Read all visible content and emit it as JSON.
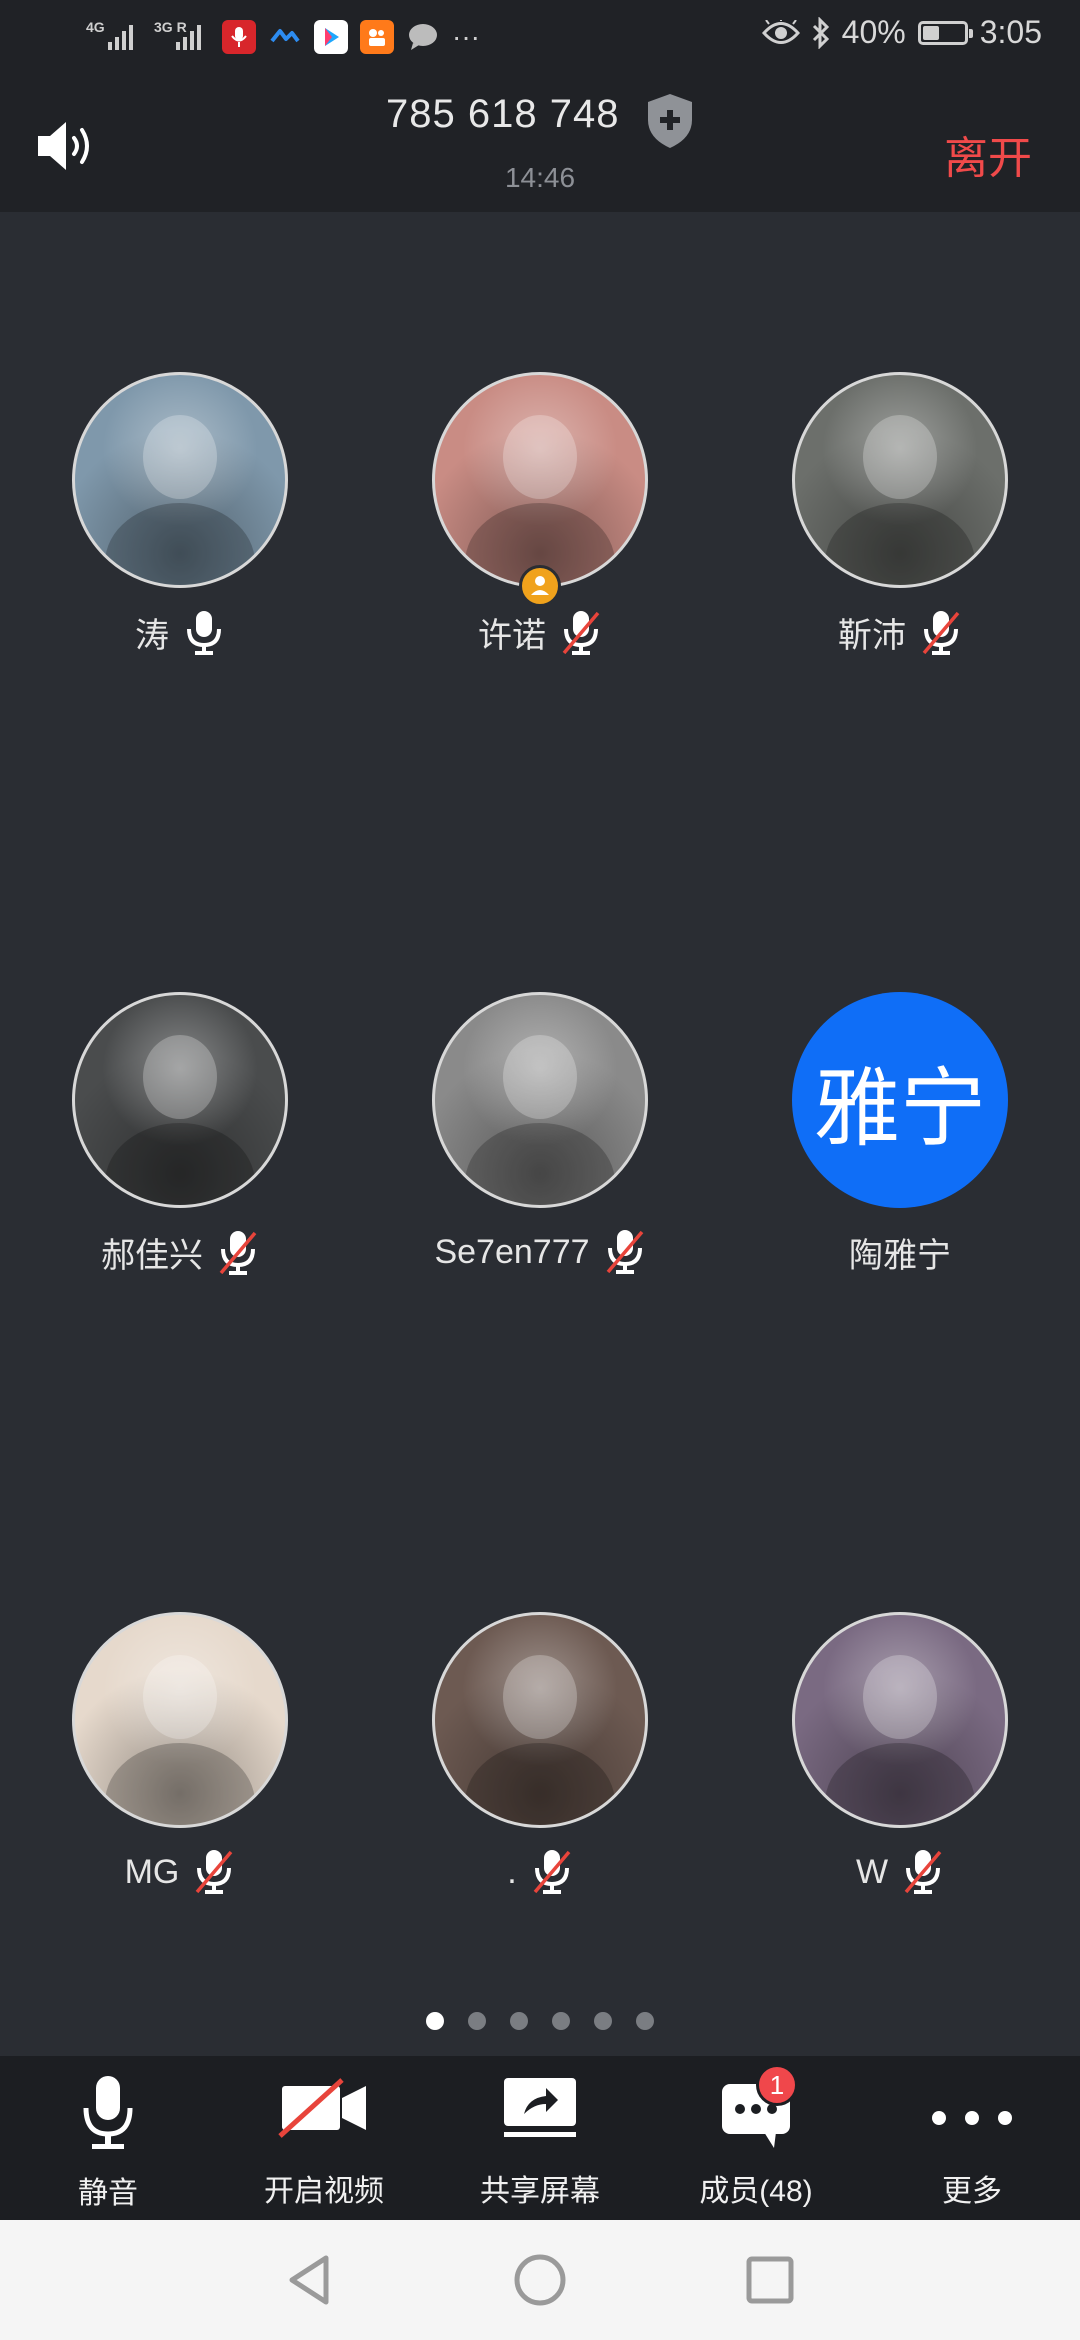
{
  "status_bar": {
    "signal_1_label": "4G",
    "signal_2_label": "3G R",
    "bluetooth_battery_text": "40%",
    "battery_level": 0.4,
    "time": "3:05",
    "more_notifications": "···",
    "notification_icons": [
      "recorder-app-icon",
      "dingtalk-app-icon",
      "youku-app-icon",
      "kuaishou-app-icon",
      "message-bubble-icon"
    ]
  },
  "header": {
    "meeting_id": "785 618 748",
    "duration": "14:46",
    "leave_label": "离开"
  },
  "participants": [
    {
      "name": "涛",
      "mic": "on",
      "avatar_color": "#7f98ab",
      "host": false
    },
    {
      "name": "许诺",
      "mic": "muted",
      "avatar_color": "#c98c84",
      "host": true
    },
    {
      "name": "靳沛",
      "mic": "muted",
      "avatar_color": "#6c6f6b",
      "host": false
    },
    {
      "name": "郝佳兴",
      "mic": "muted",
      "avatar_color": "#4a4c4d",
      "host": false
    },
    {
      "name": "Se7en777",
      "mic": "muted",
      "avatar_color": "#8a8a8a",
      "host": false
    },
    {
      "name": "陶雅宁",
      "mic": "none",
      "avatar_text": "雅宁",
      "avatar_color": "#0f6ef7",
      "host": false
    },
    {
      "name": "MG",
      "mic": "muted",
      "avatar_color": "#e6d9cc",
      "host": false
    },
    {
      "name": ".",
      "mic": "muted",
      "avatar_color": "#6d5a52",
      "host": false
    },
    {
      "name": "W",
      "mic": "muted",
      "avatar_color": "#7a6a82",
      "host": false
    }
  ],
  "pager": {
    "pages": 6,
    "current": 1
  },
  "toolbar": {
    "mute_label": "静音",
    "video_label": "开启视频",
    "share_label": "共享屏幕",
    "members_label": "成员(48)",
    "members_badge": "1",
    "more_label": "更多"
  },
  "colors": {
    "background": "#2a2d33",
    "bar": "#202226",
    "toolbar": "#1c1e22",
    "leave": "#f04a4a",
    "accent_blue": "#0f6ef7",
    "host_badge": "#f0a21c"
  }
}
